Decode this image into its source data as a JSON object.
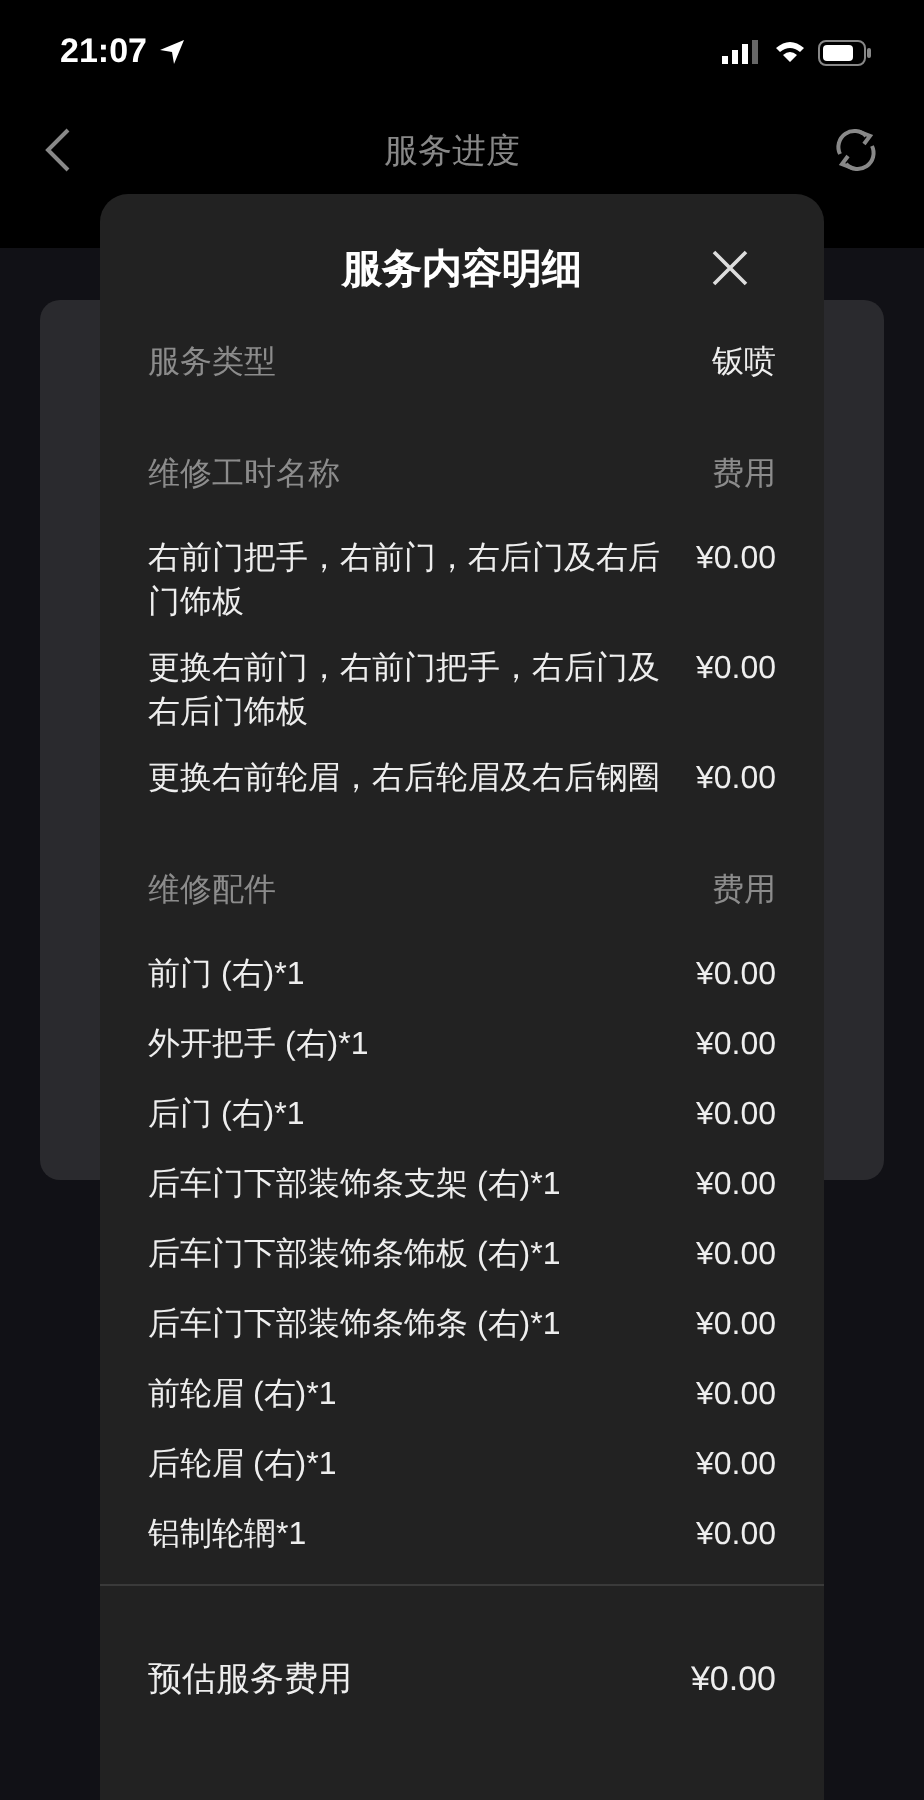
{
  "status_bar": {
    "time": "21:07"
  },
  "header": {
    "title": "服务进度"
  },
  "modal": {
    "title": "服务内容明细",
    "service_type": {
      "label": "服务类型",
      "value": "钣喷"
    },
    "labor": {
      "heading": "维修工时名称",
      "fee_heading": "费用",
      "items": [
        {
          "name": "右前门把手，右前门，右后门及右后门饰板",
          "fee": "¥0.00"
        },
        {
          "name": "更换右前门，右前门把手，右后门及右后门饰板",
          "fee": "¥0.00"
        },
        {
          "name": "更换右前轮眉，右后轮眉及右后钢圈",
          "fee": "¥0.00"
        }
      ]
    },
    "parts": {
      "heading": "维修配件",
      "fee_heading": "费用",
      "items": [
        {
          "name": "前门 (右)*1",
          "fee": "¥0.00"
        },
        {
          "name": "外开把手 (右)*1",
          "fee": "¥0.00"
        },
        {
          "name": "后门 (右)*1",
          "fee": "¥0.00"
        },
        {
          "name": "后车门下部装饰条支架 (右)*1",
          "fee": "¥0.00"
        },
        {
          "name": "后车门下部装饰条饰板 (右)*1",
          "fee": "¥0.00"
        },
        {
          "name": "后车门下部装饰条饰条 (右)*1",
          "fee": "¥0.00"
        },
        {
          "name": "前轮眉 (右)*1",
          "fee": "¥0.00"
        },
        {
          "name": "后轮眉 (右)*1",
          "fee": "¥0.00"
        },
        {
          "name": "铝制轮辋*1",
          "fee": "¥0.00"
        }
      ]
    },
    "total": {
      "label": "预估服务费用",
      "value": "¥0.00"
    }
  }
}
